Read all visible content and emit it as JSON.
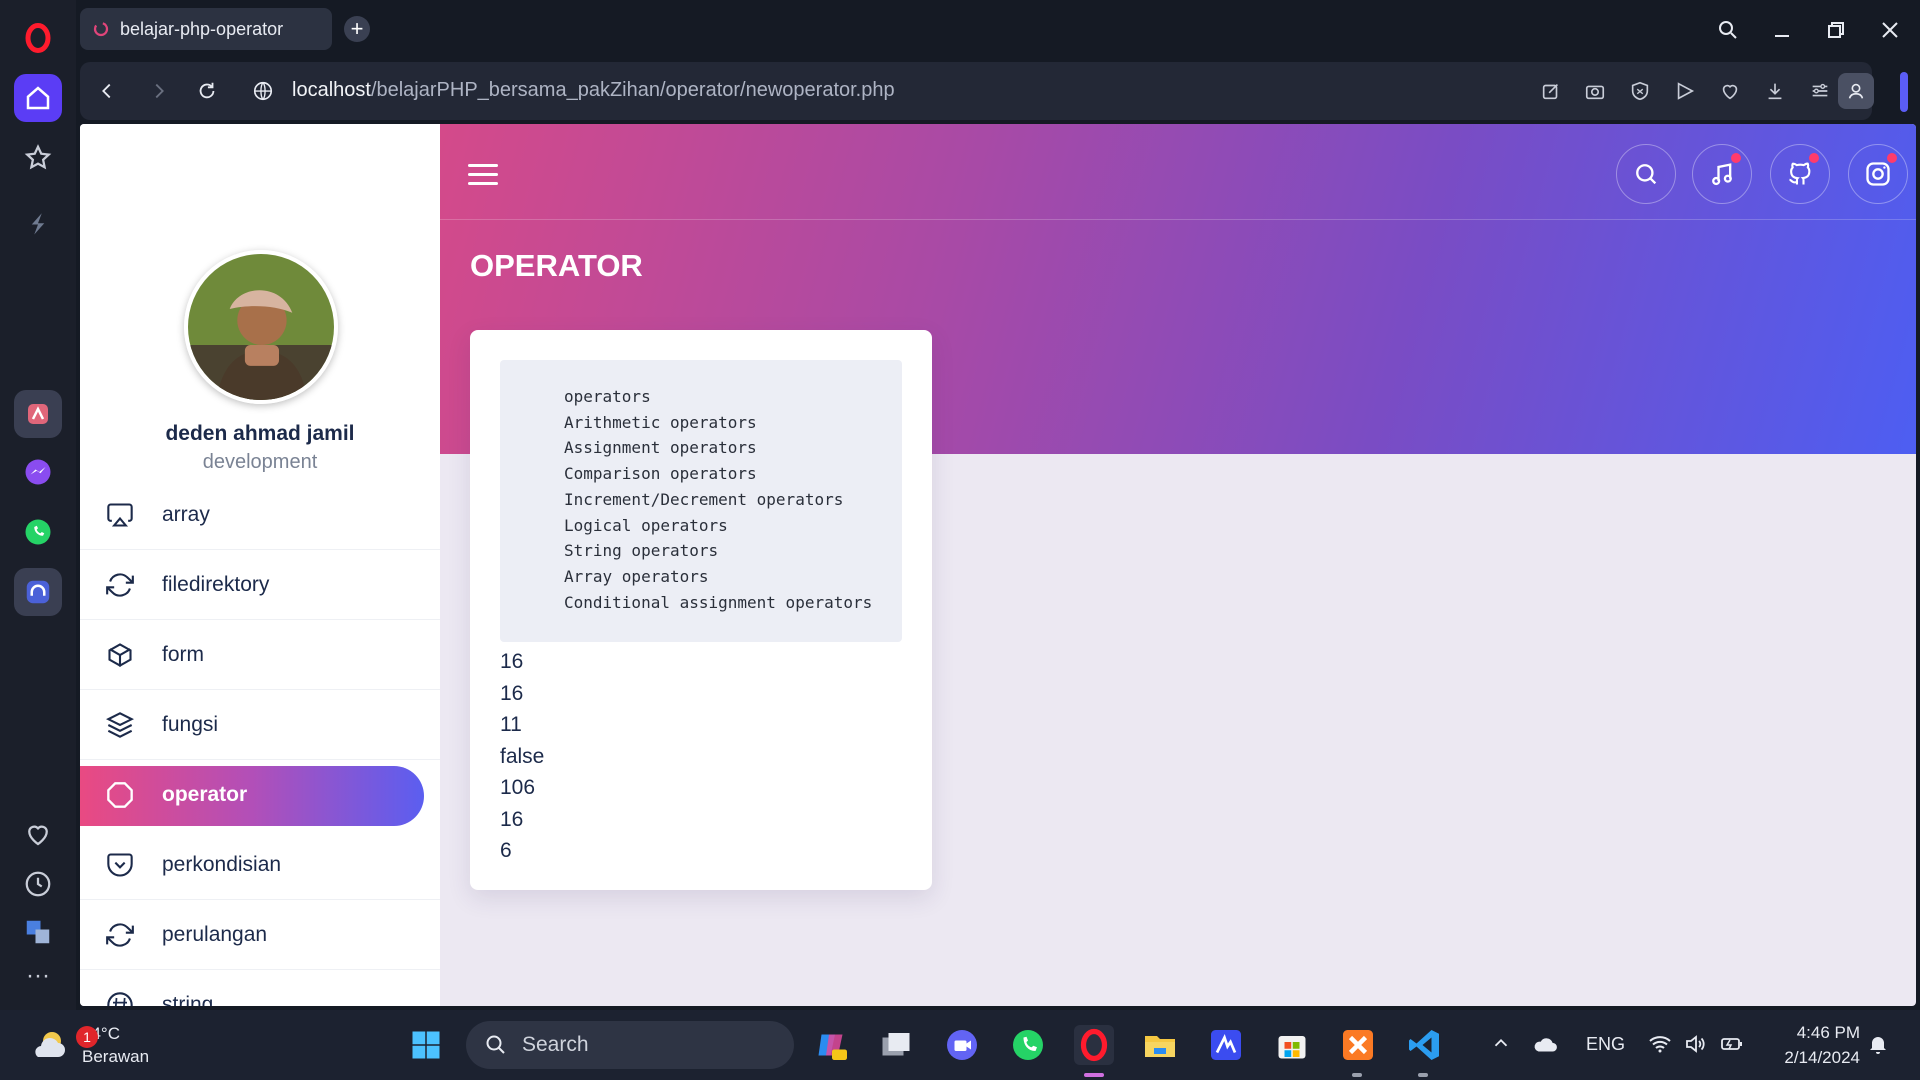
{
  "browser": {
    "tab_title": "belajar-php-operator",
    "new_tab": "+",
    "url_host": "localhost",
    "url_path": "/belajarPHP_bersama_pakZihan/operator/newoperator.php"
  },
  "sidebar": {
    "user_name": "deden ahmad jamil",
    "user_role": "development",
    "items": [
      {
        "label": "array",
        "icon": "airplay-icon"
      },
      {
        "label": "filedirektory",
        "icon": "refresh-icon"
      },
      {
        "label": "form",
        "icon": "box-icon"
      },
      {
        "label": "fungsi",
        "icon": "layers-icon"
      },
      {
        "label": "operator",
        "icon": "octagon-icon",
        "active": true
      },
      {
        "label": "perkondisian",
        "icon": "pocket-icon"
      },
      {
        "label": "perulangan",
        "icon": "refresh-icon"
      },
      {
        "label": "string",
        "icon": "hash-icon"
      }
    ]
  },
  "header": {
    "title": "OPERATOR"
  },
  "content": {
    "code_lines": [
      "operators",
      "Arithmetic operators",
      "Assignment operators",
      "Comparison operators",
      "Increment/Decrement operators",
      "Logical operators",
      "String operators",
      "Array operators",
      "Conditional assignment operators"
    ],
    "outputs": [
      "16",
      "16",
      "11",
      "false",
      "106",
      "16",
      "6"
    ]
  },
  "taskbar": {
    "weather_temp": "24°C",
    "weather_desc": "Berawan",
    "weather_badge": "1",
    "search_placeholder": "Search",
    "language": "ENG",
    "time": "4:46 PM",
    "date": "2/14/2024"
  },
  "colors": {
    "gradient_start": "#d44a8a",
    "gradient_end": "#4d5ef2",
    "page_bg": "#ece8f2",
    "text_dark": "#1c2a4a"
  }
}
